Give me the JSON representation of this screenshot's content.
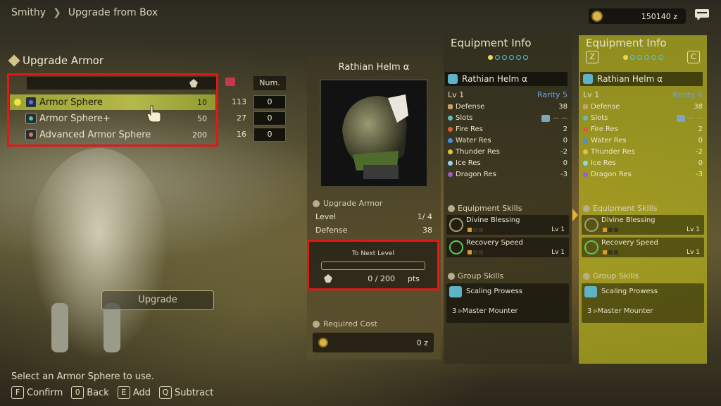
{
  "breadcrumb": [
    "Smithy",
    "Upgrade from Box"
  ],
  "money": "150140 z",
  "left_panel": {
    "title": "Upgrade Armor",
    "num_header": "Num.",
    "items": [
      {
        "name": "Armor Sphere",
        "points": "10",
        "stock": "113",
        "num": "0",
        "selected": true
      },
      {
        "name": "Armor Sphere+",
        "points": "50",
        "stock": "27",
        "num": "0",
        "selected": false
      },
      {
        "name": "Advanced Armor Sphere",
        "points": "200",
        "stock": "16",
        "num": "0",
        "selected": false
      }
    ],
    "upgrade_button": "Upgrade"
  },
  "center": {
    "item_name": "Rathian Helm α",
    "upgrade_head": "Upgrade Armor",
    "level_label": "Level",
    "level_value": "1/ 4",
    "defense_label": "Defense",
    "defense_value": "38",
    "next_level_title": "To Next Level",
    "next_level_value": "0 / 200",
    "next_level_unit": "pts",
    "next_level_progress": 0,
    "required_cost_label": "Required Cost",
    "required_cost_value": "0 z"
  },
  "equipment_info": [
    {
      "title": "Equipment Info",
      "nav_left": "",
      "nav_right": "",
      "name": "Rathian Helm α",
      "level": "Lv 1",
      "rarity": "Rarity 5",
      "stats": [
        {
          "label": "Defense",
          "value": "38",
          "color": "#c8a06a"
        },
        {
          "label": "Slots",
          "value": "— —",
          "color": "#6fb7c8"
        },
        {
          "label": "Fire Res",
          "value": "2",
          "color": "#e05b3a"
        },
        {
          "label": "Water Res",
          "value": "0",
          "color": "#4b8ee0"
        },
        {
          "label": "Thunder Res",
          "value": "-2",
          "color": "#e2c43a"
        },
        {
          "label": "Ice Res",
          "value": "0",
          "color": "#8fd7ef"
        },
        {
          "label": "Dragon Res",
          "value": "-3",
          "color": "#a05ad0"
        }
      ],
      "skills_head": "Equipment Skills",
      "skills": [
        {
          "name": "Divine Blessing",
          "level": "Lv 1"
        },
        {
          "name": "Recovery Speed",
          "level": "Lv 1"
        }
      ],
      "group_head": "Group Skills",
      "group_name": "Scaling Prowess",
      "group_sub": "3 ▹Master Mounter"
    },
    {
      "title": "Equipment Info",
      "nav_left": "Z",
      "nav_right": "C",
      "name": "Rathian Helm α",
      "level": "Lv 1",
      "rarity": "Rarity 5",
      "stats": [
        {
          "label": "Defense",
          "value": "38",
          "color": "#c8a06a"
        },
        {
          "label": "Slots",
          "value": "— —",
          "color": "#6fb7c8"
        },
        {
          "label": "Fire Res",
          "value": "2",
          "color": "#e05b3a"
        },
        {
          "label": "Water Res",
          "value": "0",
          "color": "#4b8ee0"
        },
        {
          "label": "Thunder Res",
          "value": "-2",
          "color": "#e2c43a"
        },
        {
          "label": "Ice Res",
          "value": "0",
          "color": "#8fd7ef"
        },
        {
          "label": "Dragon Res",
          "value": "-3",
          "color": "#a05ad0"
        }
      ],
      "skills_head": "Equipment Skills",
      "skills": [
        {
          "name": "Divine Blessing",
          "level": "Lv 1"
        },
        {
          "name": "Recovery Speed",
          "level": "Lv 1"
        }
      ],
      "group_head": "Group Skills",
      "group_name": "Scaling Prowess",
      "group_sub": "3 ▹Master Mounter"
    }
  ],
  "hint": "Select an Armor Sphere to use.",
  "keys": [
    {
      "key": "F",
      "label": "Confirm"
    },
    {
      "key": "0",
      "label": "Back"
    },
    {
      "key": "E",
      "label": "Add"
    },
    {
      "key": "Q",
      "label": "Subtract"
    }
  ],
  "colors": {
    "highlight_red": "#e01818",
    "selected_row": "#9aa332",
    "accent_teal": "#4fc6ea",
    "rarity_blue": "#6aa2e8"
  }
}
